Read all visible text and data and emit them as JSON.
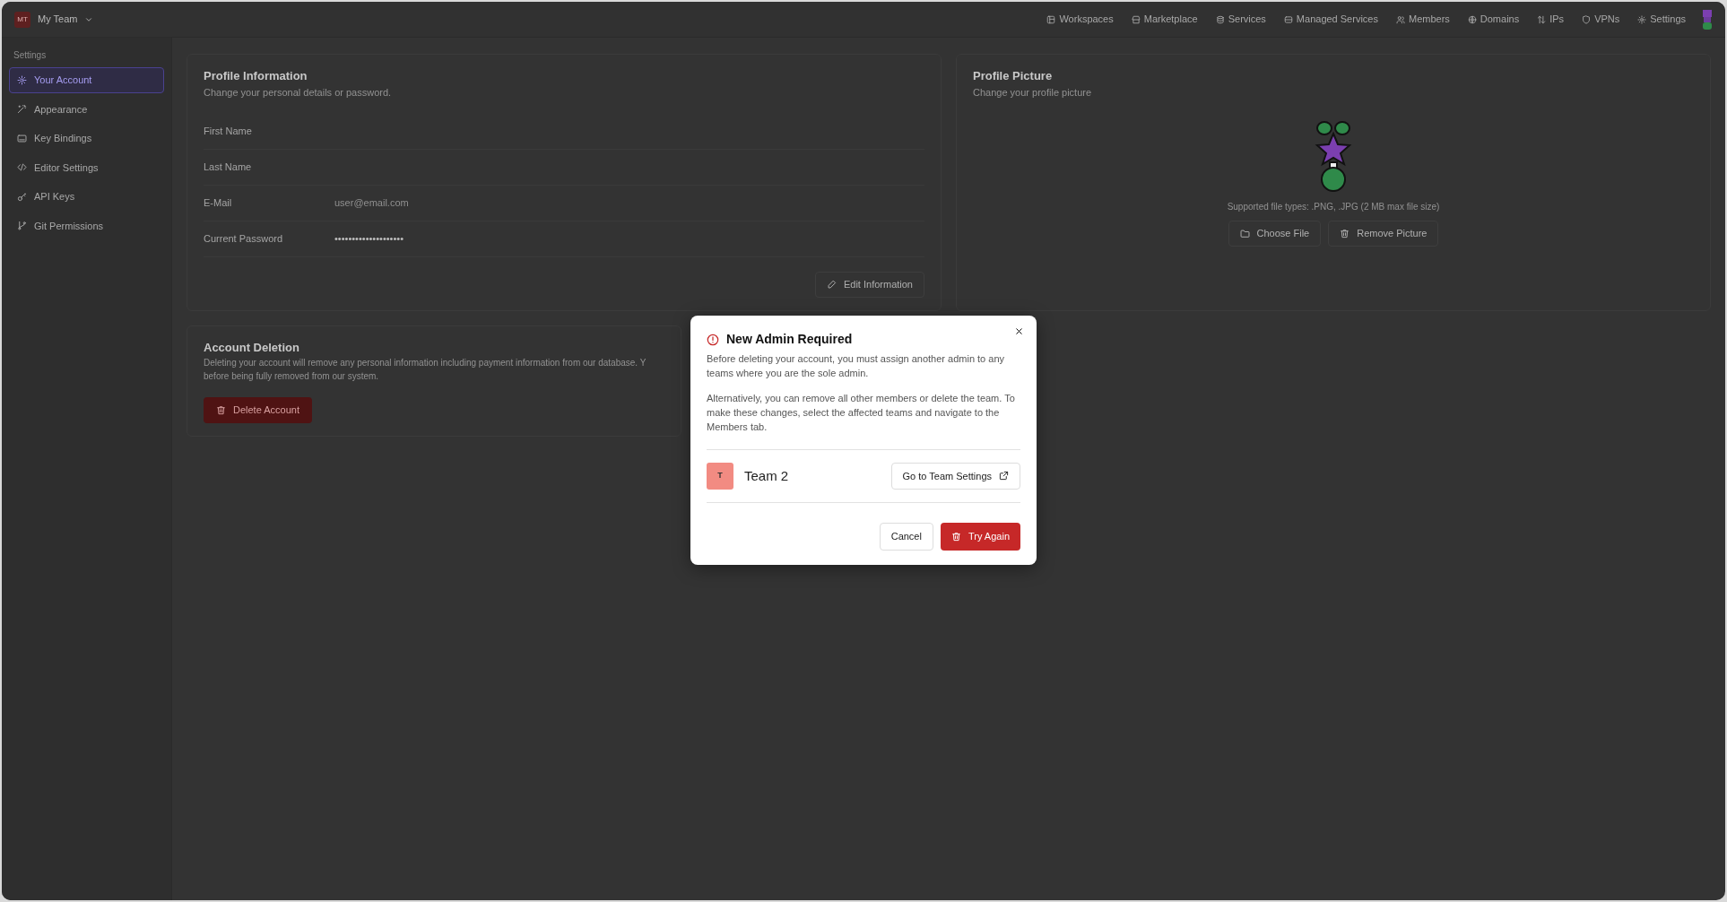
{
  "team_switcher": {
    "initials": "MT",
    "name": "My Team"
  },
  "top_nav": [
    "Workspaces",
    "Marketplace",
    "Services",
    "Managed Services",
    "Members",
    "Domains",
    "IPs",
    "VPNs",
    "Settings"
  ],
  "sidebar": {
    "heading": "Settings",
    "items": [
      {
        "label": "Your Account",
        "selected": true
      },
      {
        "label": "Appearance",
        "selected": false
      },
      {
        "label": "Key Bindings",
        "selected": false
      },
      {
        "label": "Editor Settings",
        "selected": false
      },
      {
        "label": "API Keys",
        "selected": false
      },
      {
        "label": "Git Permissions",
        "selected": false
      }
    ]
  },
  "profile_information": {
    "title": "Profile Information",
    "subtitle": "Change your personal details or password.",
    "fields": [
      {
        "label": "First Name"
      },
      {
        "label": "Last Name"
      },
      {
        "label": "E-Mail",
        "placeholder": "user@email.com"
      },
      {
        "label": "Current Password",
        "value": "••••••••••••••••••••"
      }
    ],
    "button": "Edit Information"
  },
  "profile_picture": {
    "title": "Profile Picture",
    "subtitle": "Change your profile picture",
    "hint": "Supported file types: .PNG, .JPG (2 MB max file size)",
    "buttons": [
      "Choose File",
      "Remove Picture"
    ]
  },
  "account_deletion": {
    "title": "Account Deletion",
    "description_lines": [
      "Deleting your account will remove any personal information including payment information from our database. Y",
      "before being fully removed from our system."
    ],
    "button": "Delete Account"
  },
  "modal": {
    "title": "New Admin Required",
    "paragraphs": [
      "Before deleting your account, you must assign another admin to any teams where you are the sole admin.",
      "Alternatively, you can remove all other members or delete the team. To make these changes, select the affected teams and navigate to the Members tab."
    ],
    "teams": [
      {
        "initial": "T",
        "name": "Team 2",
        "color": "#f28b82",
        "action": "Go to Team Settings"
      }
    ],
    "cancel": "Cancel",
    "confirm": "Try Again"
  }
}
